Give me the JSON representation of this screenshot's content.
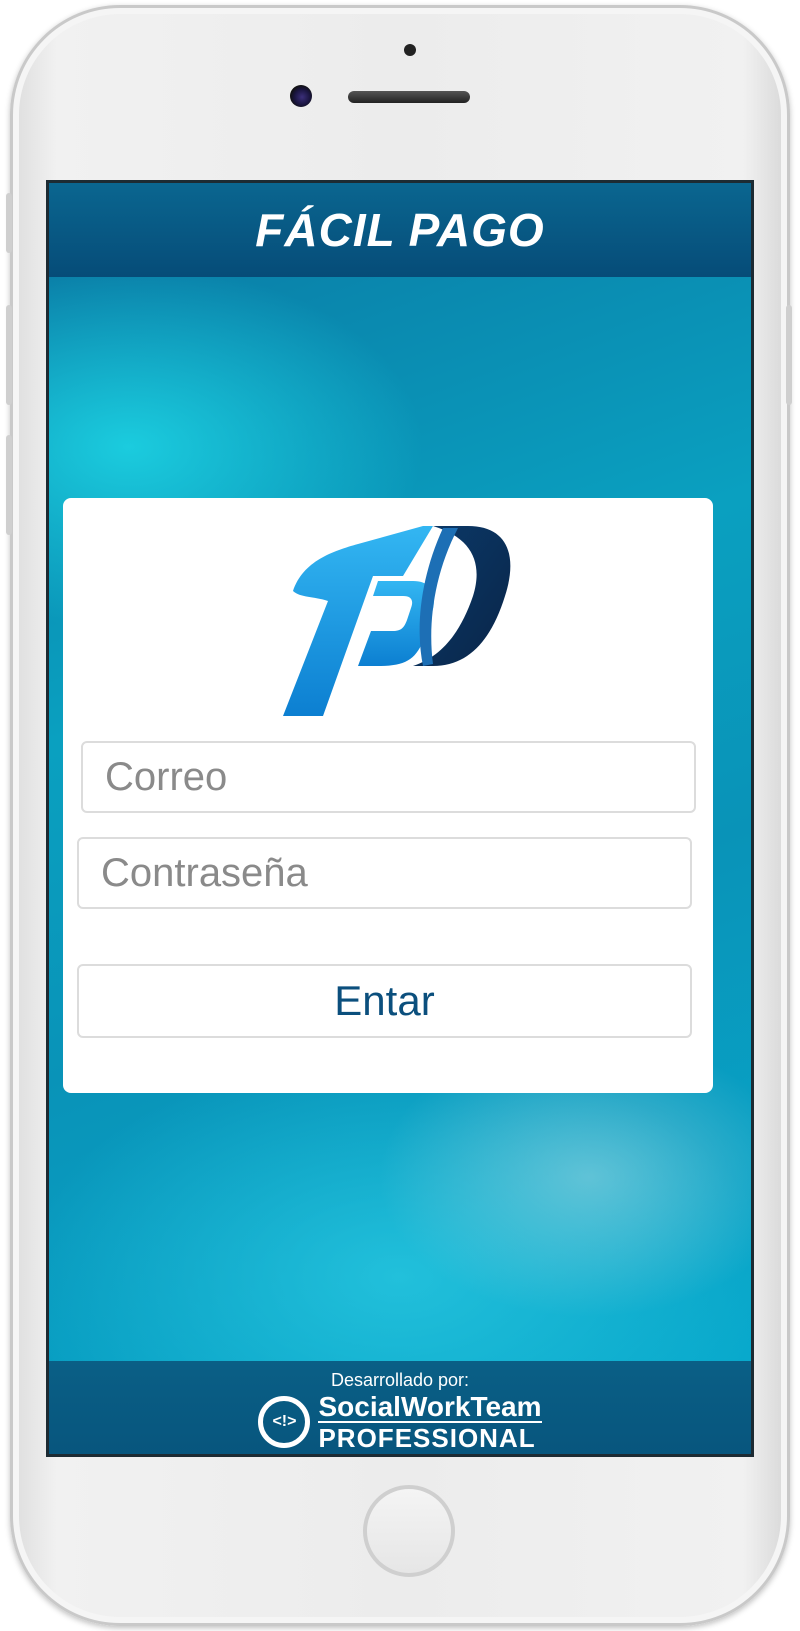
{
  "header": {
    "title": "FÁCIL PAGO"
  },
  "login": {
    "email_placeholder": "Correo",
    "password_placeholder": "Contraseña",
    "submit_label": "Entar"
  },
  "footer": {
    "credit_label": "Desarrollado por:",
    "brand_logo_mark": "<!>",
    "brand_line1": "SocialWorkTeam",
    "brand_line2": "PROFESSIONAL"
  },
  "colors": {
    "header_bg": "#064c78",
    "accent_blue": "#0b4f7d",
    "logo_light": "#1aa1e8",
    "logo_dark": "#0b2c55"
  }
}
